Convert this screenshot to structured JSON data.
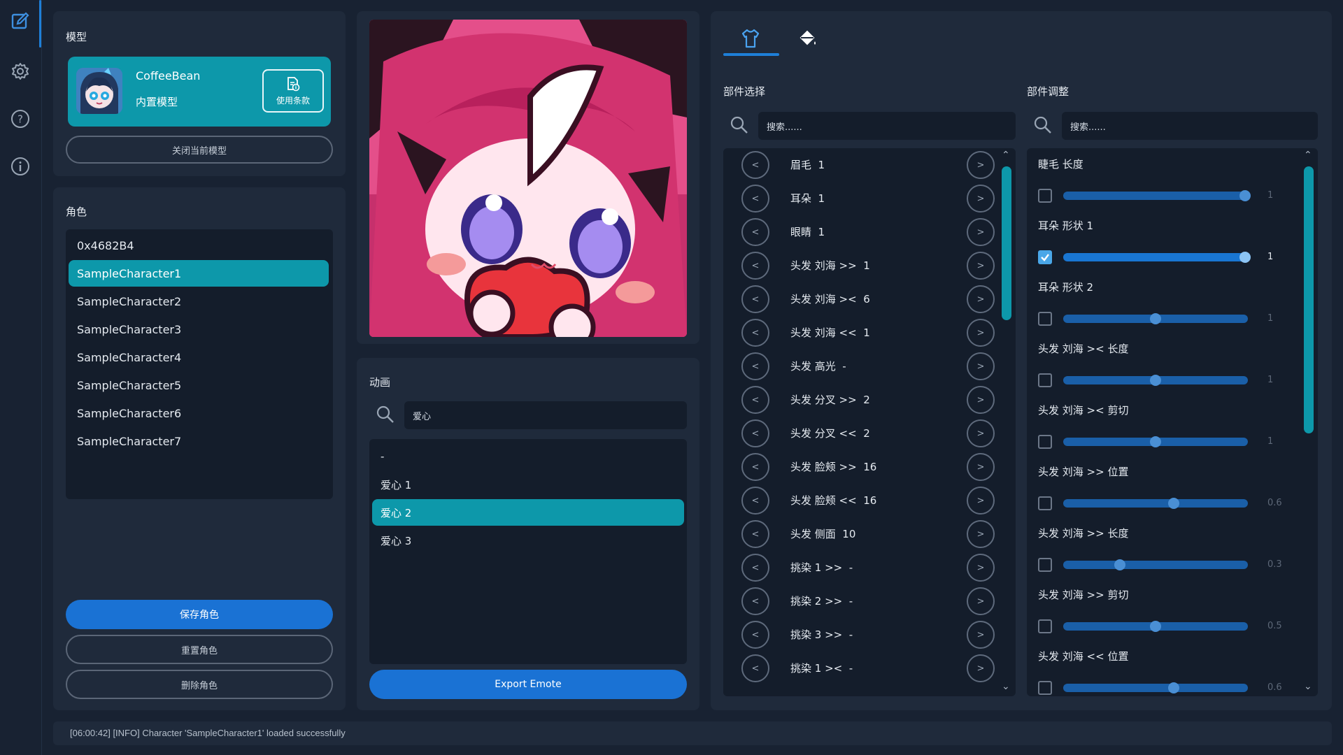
{
  "nav": {
    "items": [
      {
        "name": "edit-icon"
      },
      {
        "name": "settings-icon"
      },
      {
        "name": "help-icon"
      },
      {
        "name": "info-icon"
      }
    ]
  },
  "model": {
    "section_title": "模型",
    "name": "CoffeeBean",
    "subtitle": "内置模型",
    "terms_label": "使用条款",
    "close_label": "关闭当前模型"
  },
  "characters": {
    "section_title": "角色",
    "items": [
      "0x4682B4",
      "SampleCharacter1",
      "SampleCharacter2",
      "SampleCharacter3",
      "SampleCharacter4",
      "SampleCharacter5",
      "SampleCharacter6",
      "SampleCharacter7"
    ],
    "selected": "SampleCharacter1",
    "save_label": "保存角色",
    "reset_label": "重置角色",
    "delete_label": "删除角色"
  },
  "animation": {
    "section_title": "动画",
    "search_value": "爱心",
    "items": [
      "-",
      "爱心 1",
      "爱心 2",
      "爱心 3"
    ],
    "selected": "爱心 2",
    "export_label": "Export Emote"
  },
  "editor": {
    "tabs": [
      {
        "name": "shirt-icon"
      },
      {
        "name": "paint-bucket-icon"
      }
    ],
    "parts_title": "部件选择",
    "adjust_title": "部件调整",
    "parts_search_placeholder": "搜索......",
    "adjust_search_placeholder": "搜索......",
    "prev_glyph": "<",
    "next_glyph": ">",
    "parts": [
      "眉毛  1",
      "耳朵  1",
      "眼睛  1",
      "头发 刘海 >>  1",
      "头发 刘海 ><  6",
      "头发 刘海 <<  1",
      "头发 高光  -",
      "头发 分叉 >>  2",
      "头发 分叉 <<  2",
      "头发 脸颊 >>  16",
      "头发 脸颊 <<  16",
      "头发 侧面  10",
      "挑染 1 >>  -",
      "挑染 2 >>  -",
      "挑染 3 >>  -",
      "挑染 1 ><  -"
    ],
    "adjustments": [
      {
        "label": "睫毛 长度",
        "checked": false,
        "value": 1,
        "display": "1"
      },
      {
        "label": "耳朵 形状 1",
        "checked": true,
        "value": 1,
        "display": "1"
      },
      {
        "label": "耳朵 形状 2",
        "checked": false,
        "value": 0.5,
        "display": "1"
      },
      {
        "label": "头发 刘海 >< 长度",
        "checked": false,
        "value": 0.5,
        "display": "1"
      },
      {
        "label": "头发 刘海 >< 剪切",
        "checked": false,
        "value": 0.5,
        "display": "1"
      },
      {
        "label": "头发 刘海 >> 位置",
        "checked": false,
        "value": 0.6,
        "display": "0.6"
      },
      {
        "label": "头发 刘海 >> 长度",
        "checked": false,
        "value": 0.3,
        "display": "0.3"
      },
      {
        "label": "头发 刘海 >> 剪切",
        "checked": false,
        "value": 0.5,
        "display": "0.5"
      },
      {
        "label": "头发 刘海 << 位置",
        "checked": false,
        "value": 0.6,
        "display": "0.6"
      }
    ]
  },
  "status": {
    "message": "[06:00:42] [INFO] Character 'SampleCharacter1' loaded successfully"
  },
  "colors": {
    "accent_teal": "#0d98aa",
    "accent_blue": "#1a72d4",
    "panel": "#1f2a3b",
    "background": "#182232"
  }
}
